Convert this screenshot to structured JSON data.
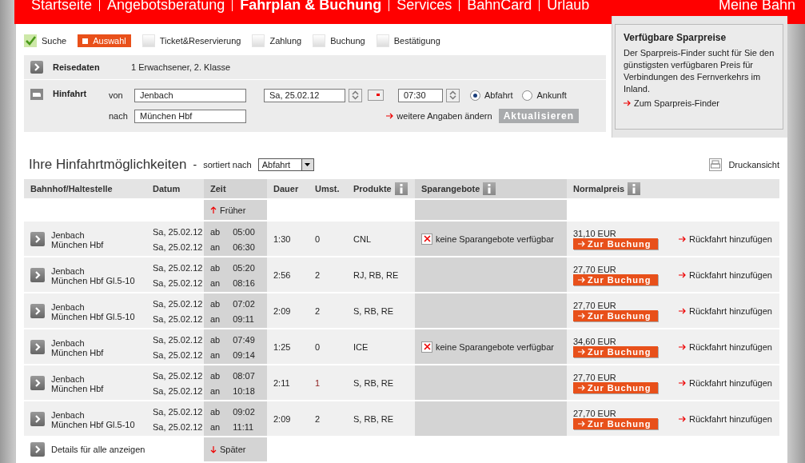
{
  "nav": {
    "items": [
      {
        "label": "Startseite",
        "selected": false
      },
      {
        "label": "Angebotsberatung",
        "selected": false
      },
      {
        "label": "Fahrplan & Buchung",
        "selected": true
      },
      {
        "label": "Services",
        "selected": false
      },
      {
        "label": "BahnCard",
        "selected": false
      },
      {
        "label": "Urlaub",
        "selected": false
      }
    ],
    "account": "Meine Bahn"
  },
  "steps": [
    {
      "label": "Suche",
      "done": true,
      "selected": false
    },
    {
      "label": "Auswahl",
      "done": false,
      "selected": true
    },
    {
      "label": "Ticket&Reservierung",
      "done": false,
      "selected": false
    },
    {
      "label": "Zahlung",
      "done": false,
      "selected": false
    },
    {
      "label": "Buchung",
      "done": false,
      "selected": false
    },
    {
      "label": "Bestätigung",
      "done": false,
      "selected": false
    }
  ],
  "reisedaten": {
    "label": "Reisedaten",
    "value": "1 Erwachsener, 2. Klasse"
  },
  "hinfahrt": {
    "label": "Hinfahrt",
    "from_label": "von",
    "from": "Jenbach",
    "to_label": "nach",
    "to": "München Hbf",
    "date": "Sa, 25.02.12",
    "time": "07:30",
    "modes": [
      {
        "label": "Abfahrt",
        "selected": true
      },
      {
        "label": "Ankunft",
        "selected": false
      }
    ],
    "more_link": "weitere Angaben ändern",
    "update_button": "Aktualisieren"
  },
  "sparpreis": {
    "title": "Verfügbare Sparpreise",
    "text": "Der Sparpreis-Finder sucht für Sie den günstigsten verfügbaren Preis für Verbindungen des Fernverkehrs im Inland.",
    "link": "Zum Sparpreis-Finder"
  },
  "results": {
    "title": "Ihre Hinfahrtmöglichkeiten",
    "separator": "-",
    "sort_label": "sortiert nach",
    "sort_value": "Abfahrt",
    "print": "Druckansicht",
    "columns": [
      "Bahnhof/Haltestelle",
      "Datum",
      "Zeit",
      "Dauer",
      "Umst.",
      "Produkte",
      "Sparangebote",
      "Normalpreis"
    ],
    "earlier": "Früher",
    "later": "Später",
    "details_all": "Details für alle anzeigen",
    "rows": [
      {
        "from": "Jenbach",
        "to": "München Hbf",
        "date_dep": "Sa, 25.02.12",
        "date_arr": "Sa, 25.02.12",
        "dep_label": "ab",
        "dep": "05:00",
        "arr_label": "an",
        "arr": "06:30",
        "duration": "1:30",
        "changes": "0",
        "products": "CNL",
        "offer": "keine Sparangebote verfügbar",
        "price": "31,10 EUR",
        "book": "Zur Buchung",
        "return": "Rückfahrt hinzufügen"
      },
      {
        "from": "Jenbach",
        "to": "München Hbf Gl.5-10",
        "date_dep": "Sa, 25.02.12",
        "date_arr": "Sa, 25.02.12",
        "dep_label": "ab",
        "dep": "05:20",
        "arr_label": "an",
        "arr": "08:16",
        "duration": "2:56",
        "changes": "2",
        "products": "RJ, RB, RE",
        "price": "27,70 EUR",
        "book": "Zur Buchung",
        "return": "Rückfahrt hinzufügen"
      },
      {
        "from": "Jenbach",
        "to": "München Hbf Gl.5-10",
        "date_dep": "Sa, 25.02.12",
        "date_arr": "Sa, 25.02.12",
        "dep_label": "ab",
        "dep": "07:02",
        "arr_label": "an",
        "arr": "09:11",
        "duration": "2:09",
        "changes": "2",
        "products": "S, RB, RE",
        "price": "27,70 EUR",
        "book": "Zur Buchung",
        "return": "Rückfahrt hinzufügen"
      },
      {
        "from": "Jenbach",
        "to": "München Hbf",
        "date_dep": "Sa, 25.02.12",
        "date_arr": "Sa, 25.02.12",
        "dep_label": "ab",
        "dep": "07:49",
        "arr_label": "an",
        "arr": "09:14",
        "duration": "1:25",
        "changes": "0",
        "products": "ICE",
        "offer": "keine Sparangebote verfügbar",
        "price": "34,60 EUR",
        "book": "Zur Buchung",
        "return": "Rückfahrt hinzufügen"
      },
      {
        "from": "Jenbach",
        "to": "München Hbf",
        "date_dep": "Sa, 25.02.12",
        "date_arr": "Sa, 25.02.12",
        "dep_label": "ab",
        "dep": "08:07",
        "arr_label": "an",
        "arr": "10:18",
        "duration": "2:11",
        "changes": "1",
        "products": "S, RB, RE",
        "price": "27,70 EUR",
        "book": "Zur Buchung",
        "return": "Rückfahrt hinzufügen"
      },
      {
        "from": "Jenbach",
        "to": "München Hbf Gl.5-10",
        "date_dep": "Sa, 25.02.12",
        "date_arr": "Sa, 25.02.12",
        "dep_label": "ab",
        "dep": "09:02",
        "arr_label": "an",
        "arr": "11:11",
        "duration": "2:09",
        "changes": "2",
        "products": "S, RB, RE",
        "price": "27,70 EUR",
        "book": "Zur Buchung",
        "return": "Rückfahrt hinzufügen"
      }
    ]
  }
}
